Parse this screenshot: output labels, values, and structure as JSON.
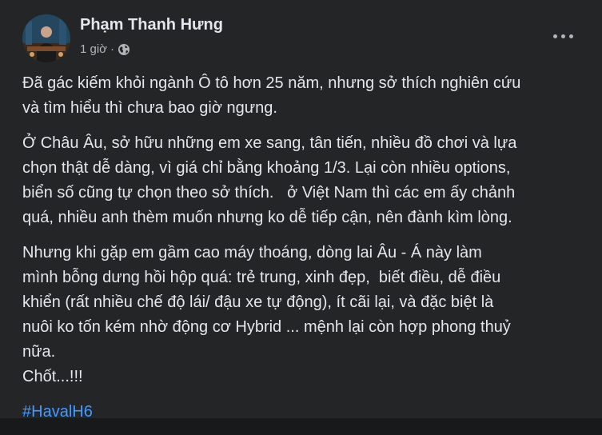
{
  "post": {
    "author": "Phạm Thanh Hưng",
    "time": "1 giờ",
    "separator": "·",
    "privacy_icon": "globe-icon",
    "menu_icon": "more-horizontal-icon",
    "paragraphs": [
      {
        "lines": [
          "Đã gác kiếm khỏi ngành Ô tô hơn 25 năm, nhưng sở thích nghiên cứu",
          "và tìm hiểu thì chưa bao giờ ngưng."
        ]
      },
      {
        "lines": [
          "Ở Châu Âu, sở hữu những em xe sang, tân tiến, nhiều đồ chơi và lựa",
          "chọn thật dễ dàng, vì giá chỉ bằng khoảng 1/3. Lại còn nhiều options,",
          "biển số cũng tự chọn theo sở thích.   ở Việt Nam thì các em ấy chảnh",
          "quá, nhiều anh thèm muốn nhưng ko dễ tiếp cận, nên đành kìm lòng."
        ]
      },
      {
        "lines": [
          "Nhưng khi gặp em gầm cao máy thoáng, dòng lai Âu - Á này làm",
          "mình bỗng dưng hồi hộp quá: trẻ trung, xinh đẹp,  biết điều, dễ điều",
          "khiển (rất nhiều chế độ lái/ đậu xe tự động), ít cãi lại, và đặc biệt là",
          "nuôi ko tốn kém nhờ động cơ Hybrid ... mệnh lại còn hợp phong thuỷ",
          "nữa.",
          "Chốt...!!!"
        ]
      }
    ],
    "hashtag": "#HavalH6",
    "colors": {
      "background": "#242526",
      "text": "#e4e6eb",
      "secondary_text": "#b0b3b8",
      "link": "#4599ff"
    }
  }
}
